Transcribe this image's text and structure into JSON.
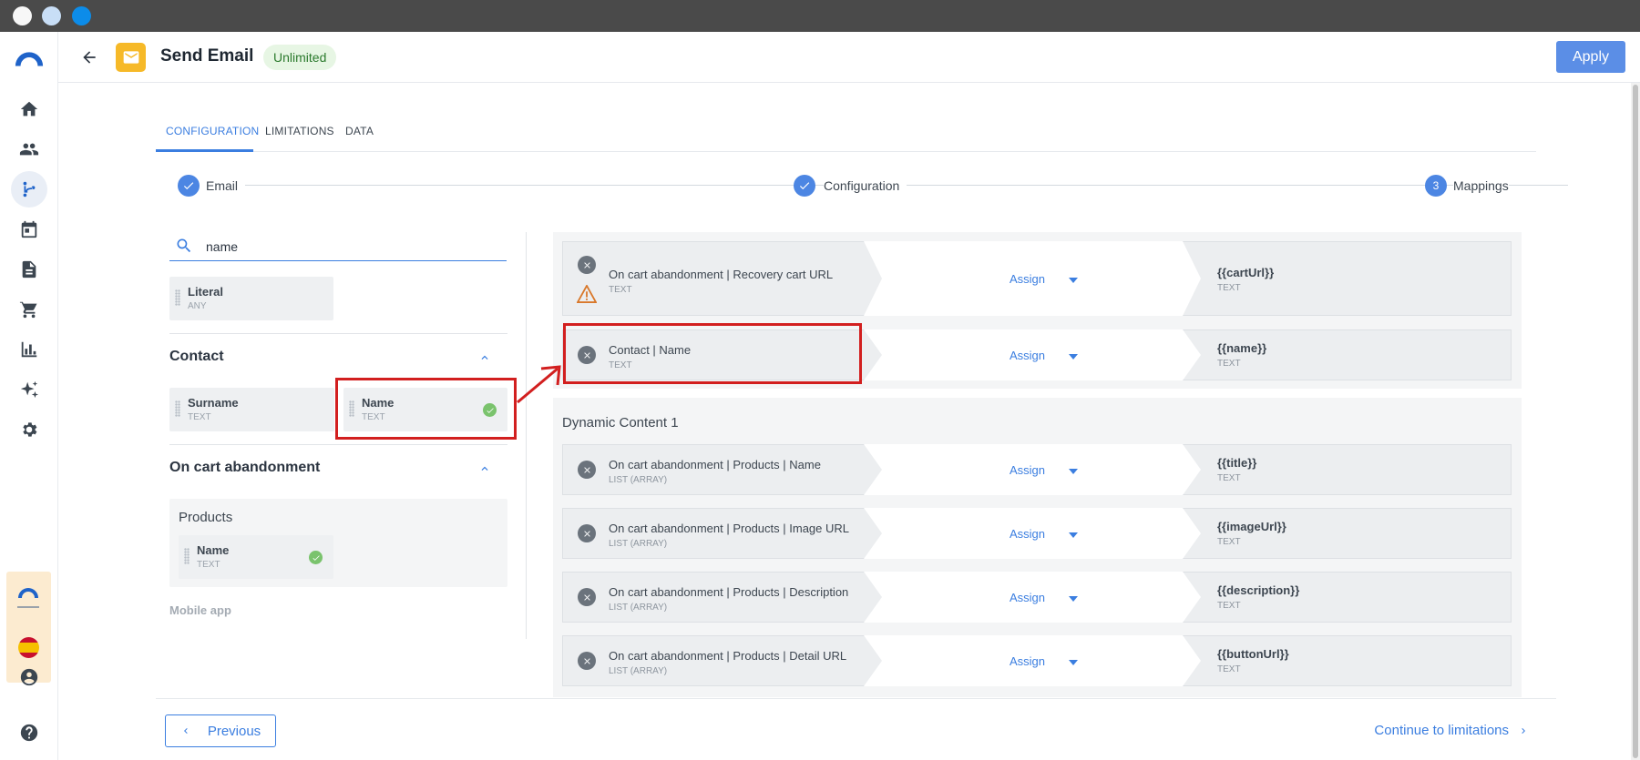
{
  "header": {
    "title": "Send Email",
    "badge": "Unlimited",
    "apply_label": "Apply"
  },
  "tabs": [
    {
      "label": "CONFIGURATION",
      "active": true
    },
    {
      "label": "LIMITATIONS",
      "active": false
    },
    {
      "label": "DATA",
      "active": false
    }
  ],
  "steps": [
    {
      "label": "Email",
      "state": "done"
    },
    {
      "label": "Configuration",
      "state": "done"
    },
    {
      "number": "3",
      "label": "Mappings",
      "state": "current"
    }
  ],
  "search": {
    "value": "name",
    "placeholder": ""
  },
  "palette": {
    "literal": {
      "label": "Literal",
      "type": "ANY"
    },
    "contact": {
      "title": "Contact",
      "items": [
        {
          "label": "Surname",
          "type": "TEXT",
          "mapped": false
        },
        {
          "label": "Name",
          "type": "TEXT",
          "mapped": true
        }
      ]
    },
    "cart": {
      "title": "On cart abandonment",
      "group": "Products",
      "items": [
        {
          "label": "Name",
          "type": "TEXT",
          "mapped": true
        }
      ]
    },
    "mobile": "Mobile app"
  },
  "mappings": {
    "assign_label": "Assign",
    "top": [
      {
        "source": "On cart abandonment | Recovery cart URL",
        "source_type": "TEXT",
        "target": "{{cartUrl}}",
        "target_type": "TEXT",
        "warning": true
      },
      {
        "source": "Contact | Name",
        "source_type": "TEXT",
        "target": "{{name}}",
        "target_type": "TEXT",
        "warning": false
      }
    ],
    "dynamic_title": "Dynamic Content 1",
    "dynamic": [
      {
        "source": "On cart abandonment | Products | Name",
        "source_type": "LIST (ARRAY)",
        "target": "{{title}}",
        "target_type": "TEXT"
      },
      {
        "source": "On cart abandonment | Products | Image URL",
        "source_type": "LIST (ARRAY)",
        "target": "{{imageUrl}}",
        "target_type": "TEXT"
      },
      {
        "source": "On cart abandonment | Products | Description",
        "source_type": "LIST (ARRAY)",
        "target": "{{description}}",
        "target_type": "TEXT"
      },
      {
        "source": "On cart abandonment | Products | Detail URL",
        "source_type": "LIST (ARRAY)",
        "target": "{{buttonUrl}}",
        "target_type": "TEXT"
      }
    ]
  },
  "footer": {
    "previous_label": "Previous",
    "continue_label": "Continue to limitations"
  },
  "colors": {
    "accent": "#3b7ee0",
    "apply": "#5b8ee6",
    "highlight": "#d21f1f",
    "app_icon": "#f6b928",
    "ok": "#7ac36d"
  },
  "icons": {
    "rail": [
      "logo-icon",
      "home-icon",
      "people-icon",
      "workflow-icon",
      "calendar-icon",
      "document-icon",
      "cart-icon",
      "chart-icon",
      "sparkle-icon",
      "settings-icon",
      "account-icon",
      "help-icon"
    ]
  }
}
